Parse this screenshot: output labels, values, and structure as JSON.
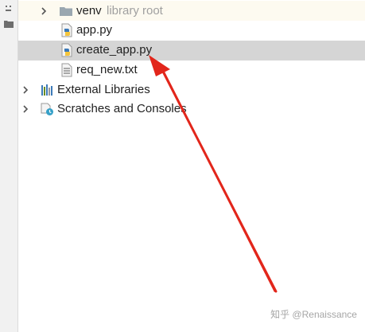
{
  "project_tree": {
    "items": [
      {
        "label": "venv",
        "hint": "library root",
        "icon": "folder-icon",
        "expandable": true
      },
      {
        "label": "app.py",
        "icon": "python-file-icon"
      },
      {
        "label": "create_app.py",
        "icon": "python-file-icon",
        "selected": true
      },
      {
        "label": "req_new.txt",
        "icon": "text-file-icon"
      },
      {
        "label": "External Libraries",
        "icon": "libraries-icon",
        "expandable": true
      },
      {
        "label": "Scratches and Consoles",
        "icon": "scratches-icon",
        "expandable": true
      }
    ]
  },
  "watermark": {
    "text": "知乎 @Renaissance"
  },
  "colors": {
    "selection": "#d5d5d5",
    "venv_row_highlight": "#fdfaf0",
    "folder": "#9aa7b0",
    "python_blue": "#3d7ab8",
    "python_yellow": "#f4c53d",
    "annotation_arrow": "#e2261b"
  }
}
